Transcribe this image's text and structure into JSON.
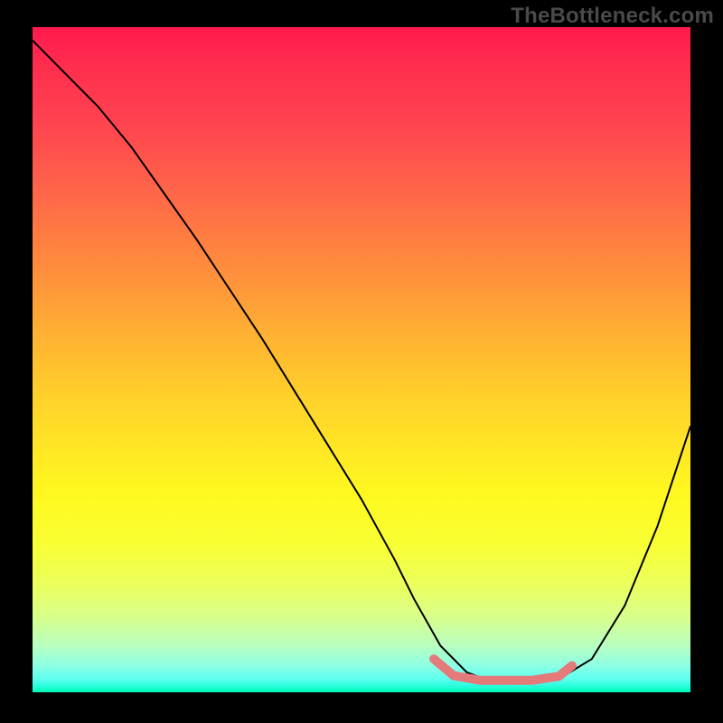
{
  "watermark": "TheBottleneck.com",
  "chart_data": {
    "type": "line",
    "title": "",
    "xlabel": "",
    "ylabel": "",
    "xlim": [
      0,
      100
    ],
    "ylim": [
      0,
      100
    ],
    "series": [
      {
        "name": "curve",
        "color": "#000000",
        "x": [
          0,
          3,
          6,
          10,
          15,
          20,
          25,
          30,
          35,
          40,
          45,
          50,
          55,
          58,
          62,
          66,
          70,
          75,
          80,
          85,
          90,
          95,
          100
        ],
        "y": [
          98,
          95,
          92,
          88,
          82,
          75,
          68,
          60.5,
          53,
          45,
          37,
          29,
          20,
          14,
          7,
          3,
          1.5,
          1.5,
          2.0,
          5,
          13,
          25,
          40
        ]
      },
      {
        "name": "highlight-band",
        "color": "#e47a7a",
        "x": [
          61,
          64,
          68,
          72,
          76,
          80,
          82
        ],
        "y": [
          5,
          2.5,
          1.8,
          1.8,
          1.8,
          2.4,
          4
        ]
      }
    ],
    "gradient_stops": [
      {
        "pos": 0,
        "color": "#ff1a4d"
      },
      {
        "pos": 50,
        "color": "#ffc62c"
      },
      {
        "pos": 75,
        "color": "#fdff23"
      },
      {
        "pos": 100,
        "color": "#00ffb8"
      }
    ]
  }
}
